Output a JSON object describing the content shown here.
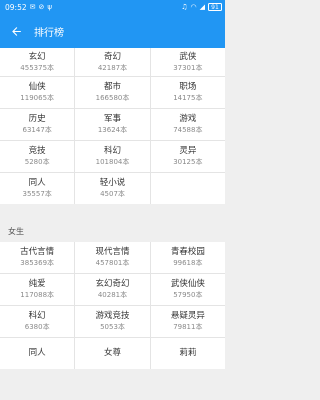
{
  "status": {
    "time": "09:52",
    "battery": "91"
  },
  "appbar": {
    "title": "排行榜"
  },
  "male": {
    "items": [
      {
        "name": "玄幻",
        "count": "455375本"
      },
      {
        "name": "奇幻",
        "count": "42187本"
      },
      {
        "name": "武侠",
        "count": "37301本"
      },
      {
        "name": "仙侠",
        "count": "119065本"
      },
      {
        "name": "都市",
        "count": "166580本"
      },
      {
        "name": "职场",
        "count": "14175本"
      },
      {
        "name": "历史",
        "count": "63147本"
      },
      {
        "name": "军事",
        "count": "13624本"
      },
      {
        "name": "游戏",
        "count": "74588本"
      },
      {
        "name": "竞技",
        "count": "5280本"
      },
      {
        "name": "科幻",
        "count": "101804本"
      },
      {
        "name": "灵异",
        "count": "30125本"
      },
      {
        "name": "同人",
        "count": "35557本"
      },
      {
        "name": "轻小说",
        "count": "4507本"
      }
    ]
  },
  "female": {
    "section_label": "女生",
    "items": [
      {
        "name": "古代言情",
        "count": "385369本"
      },
      {
        "name": "现代言情",
        "count": "457801本"
      },
      {
        "name": "青春校园",
        "count": "99618本"
      },
      {
        "name": "纯爱",
        "count": "117088本"
      },
      {
        "name": "玄幻奇幻",
        "count": "40281本"
      },
      {
        "name": "武侠仙侠",
        "count": "57950本"
      },
      {
        "name": "科幻",
        "count": "6380本"
      },
      {
        "name": "游戏竞技",
        "count": "5053本"
      },
      {
        "name": "悬疑灵异",
        "count": "79811本"
      },
      {
        "name": "同人",
        "count": ""
      },
      {
        "name": "女尊",
        "count": ""
      },
      {
        "name": "莉莉",
        "count": ""
      }
    ]
  },
  "colors": {
    "primary": "#2196f3"
  },
  "icons": {
    "back": "arrow-left-icon"
  }
}
